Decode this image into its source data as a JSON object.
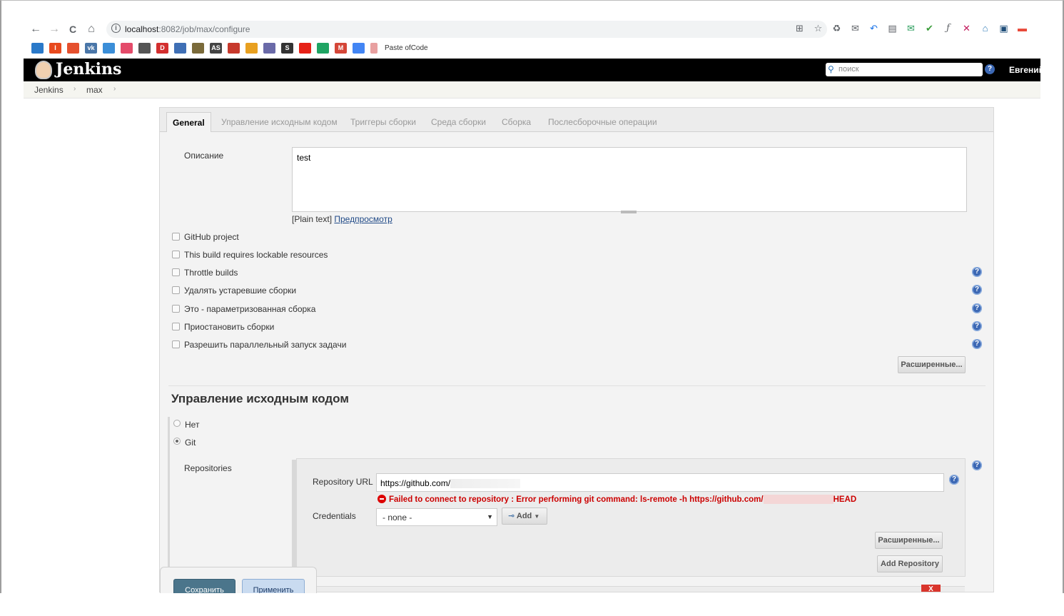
{
  "browser": {
    "url_host": "localhost",
    "url_path": ":8082/job/max/configure",
    "nav_back": "←",
    "nav_forward": "→",
    "nav_reload": "C",
    "nav_home": "⌂",
    "bookmark_paste_label": "Paste ofCode"
  },
  "header": {
    "title": "Jenkins",
    "search_placeholder": "поиск",
    "help": "?",
    "user": "Евгений"
  },
  "breadcrumb": {
    "items": [
      "Jenkins",
      "max"
    ]
  },
  "tabs": [
    "General",
    "Управление исходным кодом",
    "Триггеры сборки",
    "Среда сборки",
    "Сборка",
    "Послесборочные операции"
  ],
  "general": {
    "description_label": "Описание",
    "description_value": "test",
    "plain_text": "[Plain text]",
    "preview_link": "Предпросмотр",
    "checkboxes": [
      "GitHub project",
      "This build requires lockable resources",
      "Throttle builds",
      "Удалять устаревшие сборки",
      "Это - параметризованная сборка",
      "Приостановить сборки",
      "Разрешить параллельный запуск задачи"
    ],
    "advanced_button": "Расширенные..."
  },
  "scm": {
    "title": "Управление исходным кодом",
    "options": [
      "Нет",
      "Git"
    ],
    "selected": "Git",
    "repositories_label": "Repositories",
    "repo_url_label": "Repository URL",
    "repo_url_value": "https://github.com/",
    "error_text": "Failed to connect to repository : Error performing git command:  ls-remote -h https://github.com/",
    "error_suffix": "HEAD",
    "credentials_label": "Credentials",
    "credentials_value": "- none -",
    "add_button": "Add",
    "advanced_button": "Расширенные...",
    "add_repository_button": "Add Repository",
    "delete_button": "X"
  },
  "footer": {
    "save_button": "Сохранить",
    "apply_button": "Применить"
  },
  "colors": {
    "header_bg": "#000000",
    "error": "#cc0000",
    "help_icon": "#3c68b4",
    "save_button": "#4b758b",
    "apply_button": "#c9dbf0"
  }
}
